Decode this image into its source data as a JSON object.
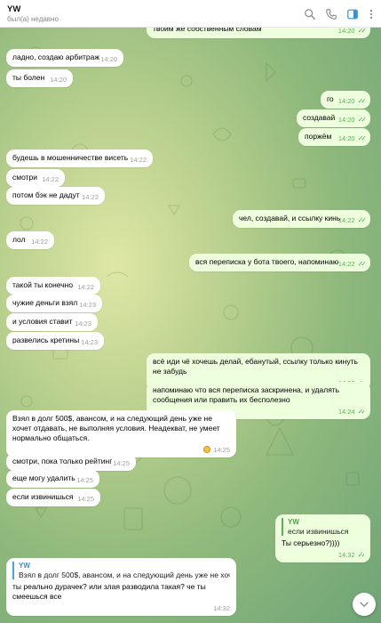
{
  "header": {
    "name": "YW",
    "status": "был(а) недавно"
  },
  "colors": {
    "outgoing_bubble": "#eeffde",
    "incoming_bubble": "#ffffff",
    "accent": "#3a8fcc",
    "check": "#4fae4e"
  },
  "icons": [
    "search-icon",
    "phone-icon",
    "sidebar-icon",
    "more-icon",
    "chevron-down-icon",
    "double-check-icon"
  ],
  "messages": [
    {
      "dir": "out",
      "text": "твоим же собственным словам",
      "time": "14:20"
    },
    {
      "dir": "in",
      "text": "ладно, создаю арбитраж",
      "time": "14:20"
    },
    {
      "dir": "in",
      "text": "ты болен",
      "time": "14:20"
    },
    {
      "dir": "out",
      "text": "го",
      "time": "14:20"
    },
    {
      "dir": "out",
      "text": "создавай",
      "time": "14:20"
    },
    {
      "dir": "out",
      "text": "поржём",
      "time": "14:20"
    },
    {
      "dir": "in",
      "text": "будешь в мошенничестве висеть",
      "time": "14:22"
    },
    {
      "dir": "in",
      "text": "смотри",
      "time": "14:22"
    },
    {
      "dir": "in",
      "text": "потом бэк не дадут",
      "time": "14:22"
    },
    {
      "dir": "out",
      "text": "чел, создавай, и ссылку кинь",
      "time": "14:22"
    },
    {
      "dir": "in",
      "text": "лол",
      "time": "14:22"
    },
    {
      "dir": "out",
      "text": "вся переписка у бота твоего, напоминаю",
      "time": "14:22"
    },
    {
      "dir": "in",
      "text": "такой ты конечно",
      "time": "14:22"
    },
    {
      "dir": "in",
      "text": "чужие деньги взял",
      "time": "14:23"
    },
    {
      "dir": "in",
      "text": "и условия ставит",
      "time": "14:23"
    },
    {
      "dir": "in",
      "text": "развелись кретины",
      "time": "14:23"
    },
    {
      "dir": "out",
      "text": "всё иди чё хочешь делай, ебанутый, ссылку только кинуть не забудь",
      "time": "14:23"
    },
    {
      "dir": "out",
      "text": "напоминаю что вся переписка заскринена, и удалять сообщения или править их бесполезно",
      "time": "14:24"
    },
    {
      "dir": "in",
      "text": "Взял в долг 500$, авансом, и на следующий день уже не хочет отдавать, не выполняя условия. Неадекват, не умеет нормально общаться.",
      "time": "14:25"
    },
    {
      "dir": "in",
      "text": "смотри, пока только рейтинг",
      "time": "14:25"
    },
    {
      "dir": "in",
      "text": "еще могу удалить",
      "time": "14:25"
    },
    {
      "dir": "in",
      "text": "если извинишься",
      "time": "14:25"
    },
    {
      "dir": "out",
      "reply_name": "YW",
      "reply_text": "если извинишься",
      "text": "Ты серьезно?))))",
      "time": "14:32"
    },
    {
      "dir": "in",
      "reply_name": "YW",
      "reply_text": "Взял в долг 500$, авансом, и на следующий день уже не хочет...",
      "text": "ты реально дурачек? или злая разводила такая? че ты смеешься все",
      "time": "14:32"
    }
  ]
}
